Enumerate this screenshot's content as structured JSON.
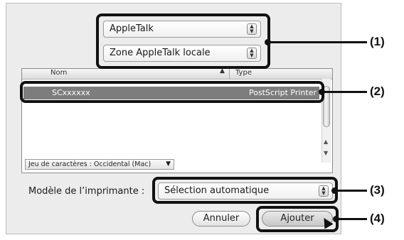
{
  "protocol_select": {
    "value": "AppleTalk"
  },
  "zone_select": {
    "value": "Zone AppleTalk locale"
  },
  "list": {
    "columns": [
      "Nom",
      "Type"
    ],
    "rows": [
      {
        "name": "SCxxxxxx",
        "type": "PostScript Printer"
      }
    ],
    "charset": "Jeu de caractères : Occidental (Mac)"
  },
  "printer_model": {
    "label": "Modèle de l’imprimante :",
    "value": "Sélection automatique"
  },
  "buttons": {
    "cancel": "Annuler",
    "add": "Ajouter"
  },
  "callouts": [
    "(1)",
    "(2)",
    "(3)",
    "(4)"
  ]
}
